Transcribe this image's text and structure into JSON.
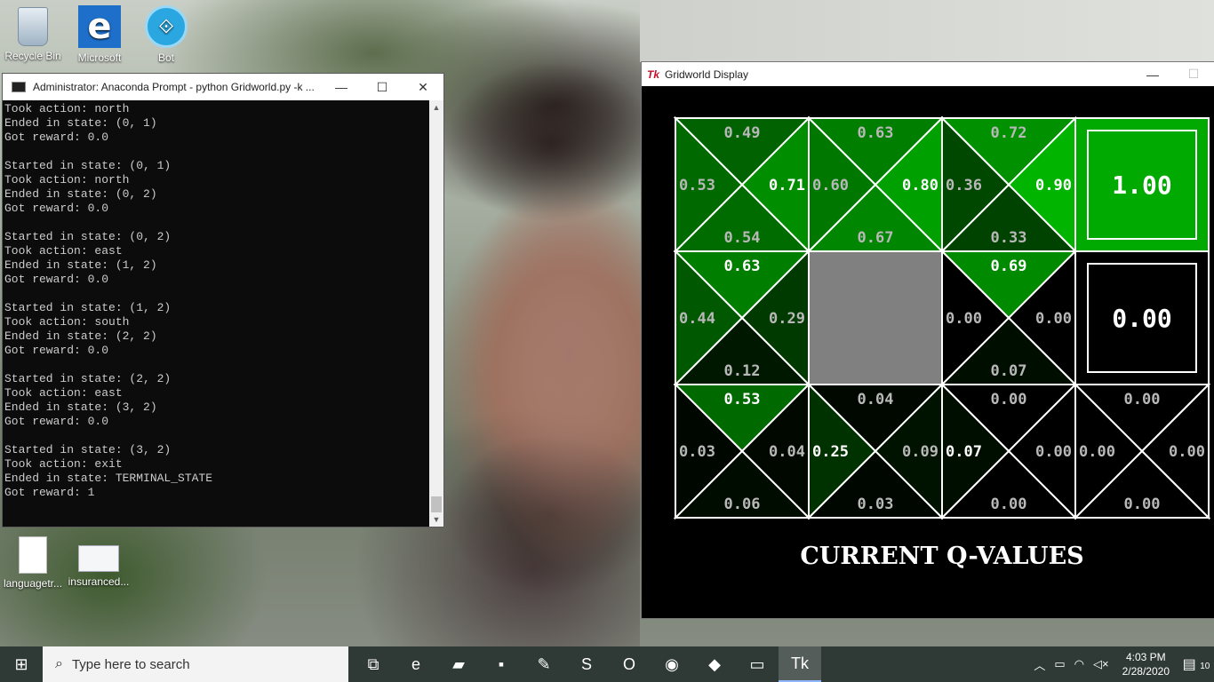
{
  "desktop": {
    "icons": [
      {
        "label": "Recycle Bin"
      },
      {
        "label": "Microsoft Edge"
      },
      {
        "label": "Bot Framewo..."
      },
      {
        "label": "languagetr..."
      },
      {
        "label": "insuranced..."
      }
    ]
  },
  "console": {
    "title": "Administrator: Anaconda Prompt - python  Gridworld.py -k ...",
    "lines": [
      "Took action: north",
      "Ended in state: (0, 1)",
      "Got reward: 0.0",
      "",
      "Started in state: (0, 1)",
      "Took action: north",
      "Ended in state: (0, 2)",
      "Got reward: 0.0",
      "",
      "Started in state: (0, 2)",
      "Took action: east",
      "Ended in state: (1, 2)",
      "Got reward: 0.0",
      "",
      "Started in state: (1, 2)",
      "Took action: south",
      "Ended in state: (2, 2)",
      "Got reward: 0.0",
      "",
      "Started in state: (2, 2)",
      "Took action: east",
      "Ended in state: (3, 2)",
      "Got reward: 0.0",
      "",
      "Started in state: (3, 2)",
      "Took action: exit",
      "Ended in state: TERMINAL_STATE",
      "Got reward: 1"
    ]
  },
  "gridworld": {
    "title": "Gridworld Display",
    "caption": "CURRENT Q-VALUES",
    "grid": [
      [
        {
          "type": "q",
          "n": "0.49",
          "e": "0.71",
          "s": "0.54",
          "w": "0.53"
        },
        {
          "type": "q",
          "n": "0.63",
          "e": "0.80",
          "s": "0.67",
          "w": "0.60"
        },
        {
          "type": "q",
          "n": "0.72",
          "e": "0.90",
          "s": "0.33",
          "w": "0.36"
        },
        {
          "type": "terminal",
          "value": "1.00",
          "color": "#00aa00"
        }
      ],
      [
        {
          "type": "q",
          "n": "0.63",
          "e": "0.29",
          "s": "0.12",
          "w": "0.44"
        },
        {
          "type": "wall",
          "color": "#808080"
        },
        {
          "type": "q",
          "n": "0.69",
          "e": "0.00",
          "s": "0.07",
          "w": "0.00"
        },
        {
          "type": "terminal",
          "value": "0.00",
          "color": "#000000"
        }
      ],
      [
        {
          "type": "q",
          "n": "0.53",
          "e": "0.04",
          "s": "0.06",
          "w": "0.03"
        },
        {
          "type": "q",
          "n": "0.04",
          "e": "0.09",
          "s": "0.03",
          "w": "0.25"
        },
        {
          "type": "q",
          "n": "0.00",
          "e": "0.00",
          "s": "0.00",
          "w": "0.07"
        },
        {
          "type": "q",
          "n": "0.00",
          "e": "0.00",
          "s": "0.00",
          "w": "0.00"
        }
      ]
    ]
  },
  "taskbar": {
    "search_placeholder": "Type here to search",
    "apps": [
      {
        "icon": "task-view-icon",
        "glyph": "⧉"
      },
      {
        "icon": "edge-icon",
        "glyph": "e"
      },
      {
        "icon": "file-explorer-icon",
        "glyph": "▰"
      },
      {
        "icon": "sticky-notes-icon",
        "glyph": "▪"
      },
      {
        "icon": "notepad-plus-icon",
        "glyph": "✎"
      },
      {
        "icon": "skype-icon",
        "glyph": "S"
      },
      {
        "icon": "outlook-icon",
        "glyph": "O"
      },
      {
        "icon": "chrome-icon",
        "glyph": "◉"
      },
      {
        "icon": "azure-studio-icon",
        "glyph": "◆"
      },
      {
        "icon": "terminal-icon",
        "glyph": "▭"
      },
      {
        "icon": "tk-icon",
        "glyph": "Tk"
      }
    ],
    "time": "4:03 PM",
    "date": "2/28/2020",
    "notifications": "10"
  }
}
